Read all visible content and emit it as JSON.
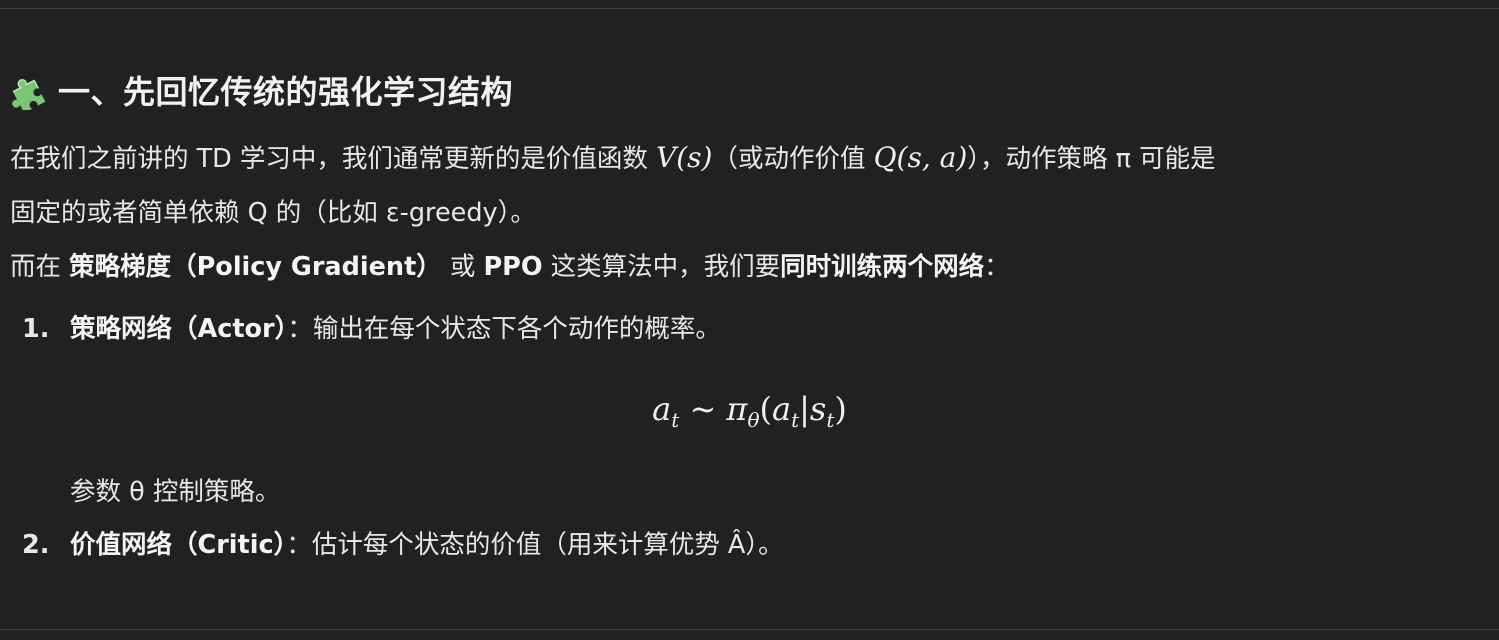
{
  "heading": {
    "icon": "puzzle-icon",
    "text": "一、先回忆传统的强化学习结构"
  },
  "para1": {
    "a": "在我们之前讲的 TD 学习中，我们通常更新的是价值函数 ",
    "m1": "V(s)",
    "b": "（或动作价值 ",
    "m2": "Q(s, a)",
    "c": "），动作策略 π 可能是",
    "d": "固定的或者简单依赖 Q 的（比如 ε-greedy）。"
  },
  "para2": {
    "a": "而在 ",
    "b1": "策略梯度（Policy Gradient）",
    "c": " 或 ",
    "b2": "PPO",
    "d": " 这类算法中，我们要",
    "b3": "同时训练两个网络",
    "e": "："
  },
  "list": [
    {
      "num": "1.",
      "title": "策略网络（Actor）",
      "desc": "：输出在每个状态下各个动作的概率。"
    },
    {
      "num": "2.",
      "title": "价值网络（Critic）",
      "desc": "：估计每个状态的价值（用来计算优势 Â）。"
    }
  ],
  "formula": {
    "a": "a",
    "t1": "t",
    "sim": " ∼ ",
    "pi": "π",
    "theta": "θ",
    "open": "(",
    "a2": "a",
    "t2": "t",
    "bar": "|",
    "s": "s",
    "t3": "t",
    "close": ")"
  },
  "param_note": "参数 θ 控制策略。",
  "colors": {
    "background": "#212121",
    "text": "#ececec",
    "divider": "#3f3f3f",
    "puzzle_green": "#7cc576"
  }
}
